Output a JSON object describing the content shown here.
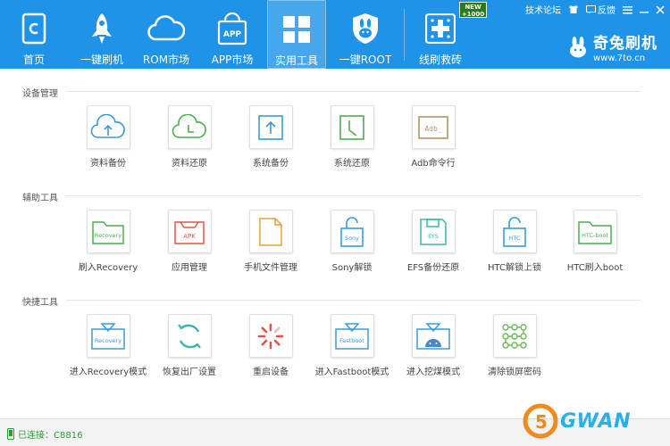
{
  "header": {
    "nav": [
      {
        "label": "首页",
        "icon": "home-icon"
      },
      {
        "label": "一键刷机",
        "icon": "rocket-icon"
      },
      {
        "label": "ROM市场",
        "icon": "cloud-icon"
      },
      {
        "label": "APP市场",
        "icon": "app-bag-icon"
      },
      {
        "label": "实用工具",
        "icon": "grid-icon",
        "active": true
      },
      {
        "label": "一键ROOT",
        "icon": "shield-rabbit-icon"
      },
      {
        "label": "线刷救砖",
        "icon": "plus-dots-icon"
      }
    ],
    "new_badge": {
      "line1": "NEW",
      "line2": "+1000"
    },
    "top_links": {
      "forum": "技术论坛",
      "feedback": "反馈"
    },
    "brand": {
      "name": "奇兔刷机",
      "url": "www.7to.cn"
    }
  },
  "sections": [
    {
      "title": "设备管理",
      "tools": [
        {
          "label": "资料备份",
          "icon": "cloud-upload-icon"
        },
        {
          "label": "资料还原",
          "icon": "cloud-clock-icon"
        },
        {
          "label": "系统备份",
          "icon": "upload-box-icon"
        },
        {
          "label": "系统还原",
          "icon": "clock-box-icon"
        },
        {
          "label": "Adb命令行",
          "icon": "adb-terminal-icon",
          "icon_text": "Adb_"
        }
      ]
    },
    {
      "title": "辅助工具",
      "tools": [
        {
          "label": "刷入Recovery",
          "icon": "recovery-folder-icon",
          "icon_text": "Recovery"
        },
        {
          "label": "应用管理",
          "icon": "apk-box-icon",
          "icon_text": "APK"
        },
        {
          "label": "手机文件管理",
          "icon": "file-icon"
        },
        {
          "label": "Sony解锁",
          "icon": "sony-lock-icon",
          "icon_text": "Sony"
        },
        {
          "label": "EFS备份还原",
          "icon": "efs-disk-icon",
          "icon_text": "EFS"
        },
        {
          "label": "HTC解锁上锁",
          "icon": "htc-lock-icon",
          "icon_text": "HTC"
        },
        {
          "label": "HTC刷入boot",
          "icon": "htc-boot-folder-icon",
          "icon_text": "HTC-boot"
        }
      ]
    },
    {
      "title": "快捷工具",
      "tools": [
        {
          "label": "进入Recovery模式",
          "icon": "recovery-mode-icon",
          "icon_text": "Recovery"
        },
        {
          "label": "恢复出厂设置",
          "icon": "factory-reset-icon"
        },
        {
          "label": "重启设备",
          "icon": "reboot-spinner-icon"
        },
        {
          "label": "进入Fastboot模式",
          "icon": "fastboot-mode-icon",
          "icon_text": "Fastboot"
        },
        {
          "label": "进入挖煤模式",
          "icon": "android-download-icon"
        },
        {
          "label": "清除锁屏密码",
          "icon": "pattern-lock-icon"
        }
      ]
    }
  ],
  "status": {
    "text": "已连接：C8816"
  },
  "watermark": {
    "text": "GWAN",
    "prefix": "5"
  },
  "colors": {
    "header": "#1f93e8",
    "blue_icon": "#3b9bd9",
    "green_icon": "#4caf50",
    "red_icon": "#e5534b",
    "orange_icon": "#e89d36",
    "status_green": "#2e9a34"
  }
}
